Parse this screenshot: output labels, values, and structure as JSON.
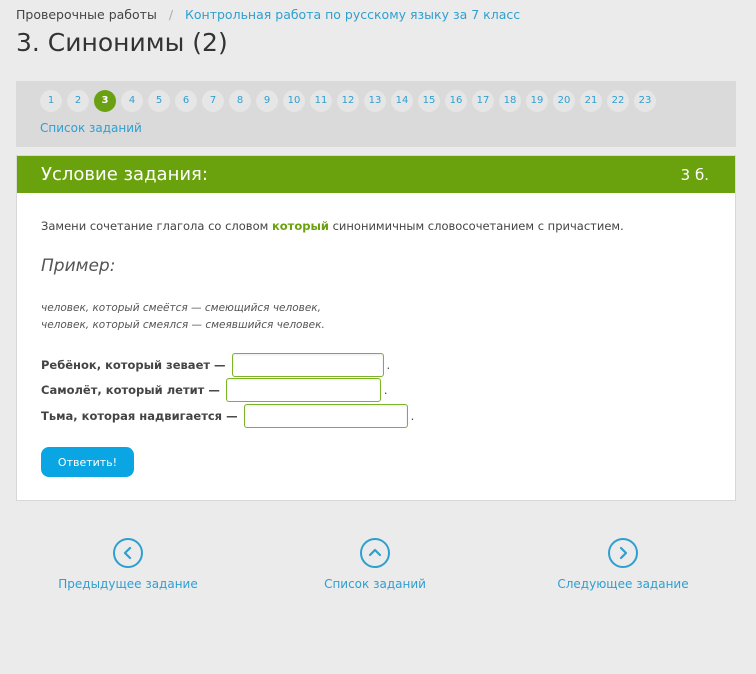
{
  "breadcrumb": {
    "root": "Проверочные работы",
    "separator": "/",
    "current": "Контрольная работа по русскому языку за 7 класс"
  },
  "page_title": "3. Синонимы (2)",
  "task_nav": {
    "pages": [
      "1",
      "2",
      "3",
      "4",
      "5",
      "6",
      "7",
      "8",
      "9",
      "10",
      "11",
      "12",
      "13",
      "14",
      "15",
      "16",
      "17",
      "18",
      "19",
      "20",
      "21",
      "22",
      "23"
    ],
    "active_page": "3",
    "list_link": "Список заданий"
  },
  "task": {
    "header_title": "Условие задания:",
    "score": "3 б.",
    "instruction_before": "Замени сочетание глагола со словом ",
    "instruction_keyword": "который",
    "instruction_after": " синонимичным словосочетанием с причастием.",
    "example_title": "Пример:",
    "example_lines": [
      "человек, который смеётся — смеющийся человек,",
      "человек, который смеялся — смеявшийся человек."
    ],
    "questions": [
      {
        "label": "Ребёнок, который зевает —",
        "value": "",
        "suffix": "."
      },
      {
        "label": "Самолёт, который летит —",
        "value": "",
        "suffix": "."
      },
      {
        "label": "Тьма, которая надвигается —",
        "value": "",
        "suffix": "."
      }
    ],
    "submit_label": "Ответить!"
  },
  "bottom_nav": {
    "prev_label": "Предыдущее задание",
    "list_label": "Список заданий",
    "next_label": "Следующее задание"
  },
  "colors": {
    "accent_green": "#6aa20e",
    "link_blue": "#2f9fd0",
    "button_blue": "#0aa6e3",
    "background": "#ebebeb"
  }
}
